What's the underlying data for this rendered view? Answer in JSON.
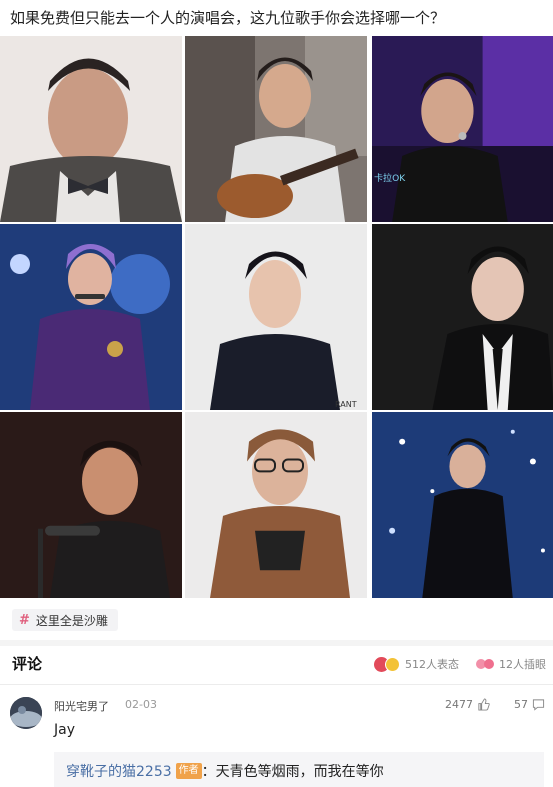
{
  "post": {
    "title": "如果免费但只能去一个人的演唱会，这九位歌手你会选择哪一个？"
  },
  "tag": {
    "symbol": "#",
    "label": "这里全是沙雕"
  },
  "comments": {
    "title": "评论",
    "reactions_label": "512人表态",
    "illustrations_label": "12人插眼"
  },
  "comment": {
    "username": "阳光宅男了",
    "date": "02-03",
    "likes": "2477",
    "replies": "57",
    "text": "Jay",
    "reply": {
      "user": "穿靴子的猫2253",
      "badge": "作者",
      "text": "：天青色等烟雨，而我在等你"
    }
  },
  "colors": {
    "tag_hash": "#e0607e",
    "reply_user": "#4a6fa5",
    "author_badge": "#f0a24a"
  }
}
